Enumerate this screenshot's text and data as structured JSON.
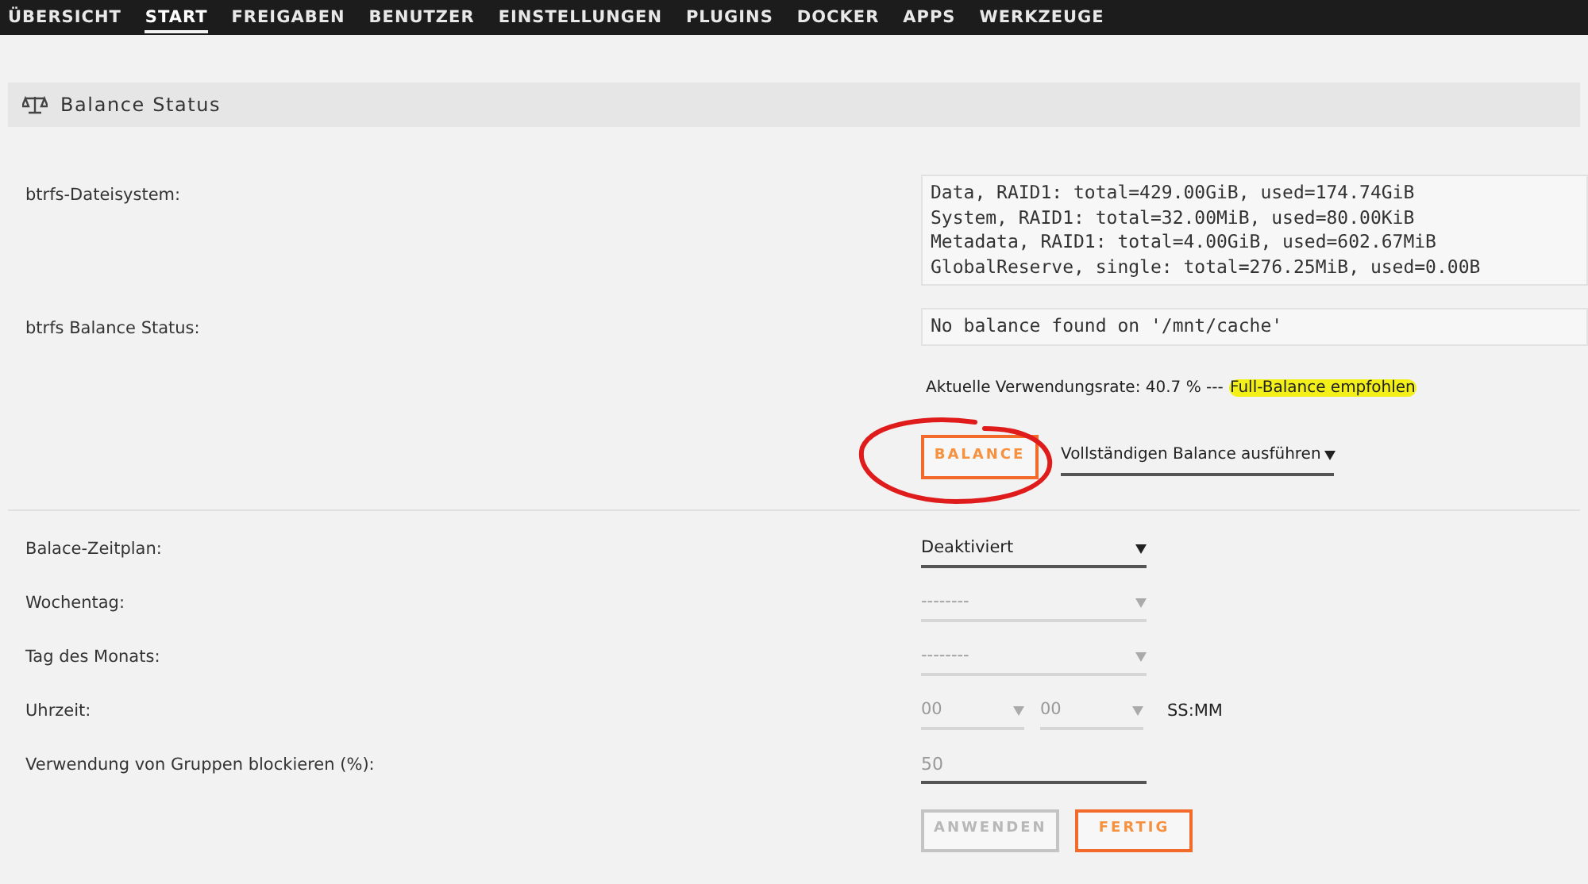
{
  "nav": [
    {
      "label": "ÜBERSICHT",
      "selected": false
    },
    {
      "label": "START",
      "selected": true
    },
    {
      "label": "FREIGABEN",
      "selected": false
    },
    {
      "label": "BENUTZER",
      "selected": false
    },
    {
      "label": "EINSTELLUNGEN",
      "selected": false
    },
    {
      "label": "PLUGINS",
      "selected": false
    },
    {
      "label": "DOCKER",
      "selected": false
    },
    {
      "label": "APPS",
      "selected": false
    },
    {
      "label": "WERKZEUGE",
      "selected": false
    }
  ],
  "section": {
    "title": "Balance Status"
  },
  "status": [
    {
      "label": "btrfs-Dateisystem:",
      "lines": [
        "Data, RAID1: total=429.00GiB, used=174.74GiB",
        "System, RAID1: total=32.00MiB, used=80.00KiB",
        "Metadata, RAID1: total=4.00GiB, used=602.67MiB",
        "GlobalReserve, single: total=276.25MiB, used=0.00B"
      ]
    },
    {
      "label": "btrfs Balance Status:",
      "lines": [
        "No balance found on '/mnt/cache'"
      ]
    }
  ],
  "usage": {
    "text": "Aktuelle Verwendungsrate: 40.7 % --- ",
    "highlight": "Full-Balance empfohlen"
  },
  "balance": {
    "button": "BALANCE",
    "mode": "Vollständigen Balance ausführen",
    "circled": true
  },
  "schedule": [
    {
      "kind": "select",
      "label": "Balace-Zeitplan:",
      "value": "Deaktiviert",
      "disabled": false
    },
    {
      "kind": "select",
      "label": "Wochentag:",
      "value": "--------",
      "disabled": true
    },
    {
      "kind": "select",
      "label": "Tag des Monats:",
      "value": "--------",
      "disabled": true
    },
    {
      "kind": "time",
      "label": "Uhrzeit:",
      "hour": "00",
      "minute": "00",
      "suffix": "SS:MM",
      "disabled": true
    },
    {
      "kind": "input",
      "label": "Verwendung von Gruppen blockieren (%):",
      "value": "50",
      "disabled": true
    }
  ],
  "buttons": [
    {
      "label": "ANWENDEN",
      "disabled": true
    },
    {
      "label": "FERTIG",
      "disabled": false
    }
  ]
}
